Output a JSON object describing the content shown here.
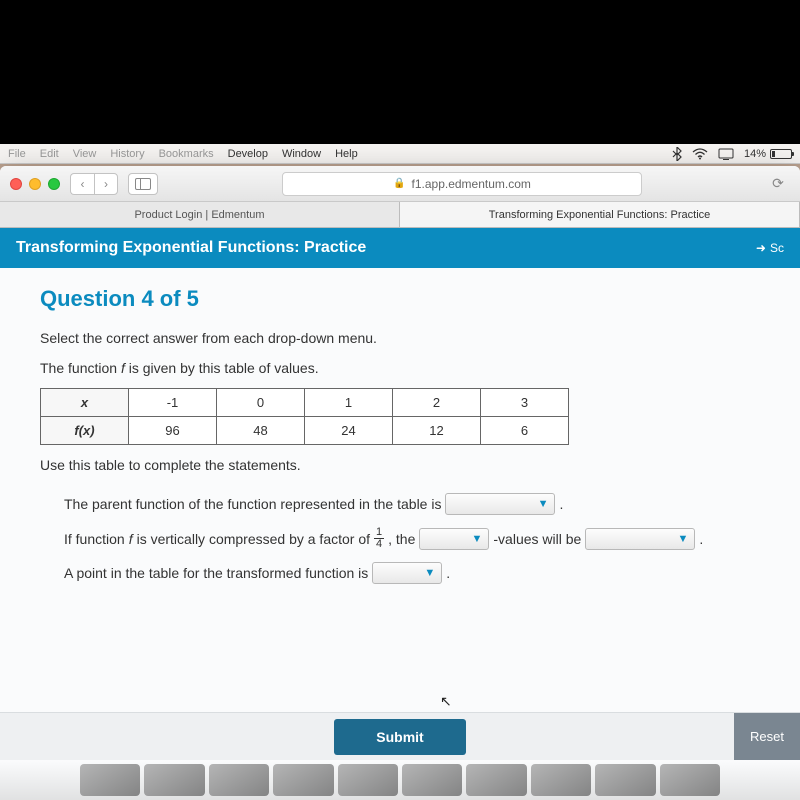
{
  "menubar": {
    "items_dim": [
      "File",
      "Edit",
      "View",
      "History",
      "Bookmarks"
    ],
    "items": [
      "Develop",
      "Window",
      "Help"
    ],
    "battery_pct": "14%"
  },
  "browser": {
    "url_host": "f1.app.edmentum.com",
    "tabs": [
      {
        "label": "Product Login | Edmentum"
      },
      {
        "label": "Transforming Exponential Functions: Practice"
      }
    ]
  },
  "banner": {
    "title": "Transforming Exponential Functions: Practice",
    "score_label": "Sc"
  },
  "question": {
    "heading": "Question 4 of 5",
    "instruction": "Select the correct answer from each drop-down menu.",
    "prompt_prefix": "The function ",
    "prompt_var": "f",
    "prompt_suffix": " is given by this table of values.",
    "table": {
      "row_headers": [
        "x",
        "f(x)"
      ],
      "x": [
        "-1",
        "0",
        "1",
        "2",
        "3"
      ],
      "fx": [
        "96",
        "48",
        "24",
        "12",
        "6"
      ]
    },
    "complete_stmt": "Use this table to complete the statements.",
    "line1_a": "The parent function of the function represented in the table is ",
    "line2_a": "If function ",
    "line2_var": "f",
    "line2_b": " is vertically compressed by a factor of ",
    "line2_frac_n": "1",
    "line2_frac_d": "4",
    "line2_c": ", the ",
    "line2_d": " -values will be ",
    "line3_a": "A point in the table for the transformed function is ",
    "period": "."
  },
  "buttons": {
    "submit": "Submit",
    "reset": "Reset"
  }
}
